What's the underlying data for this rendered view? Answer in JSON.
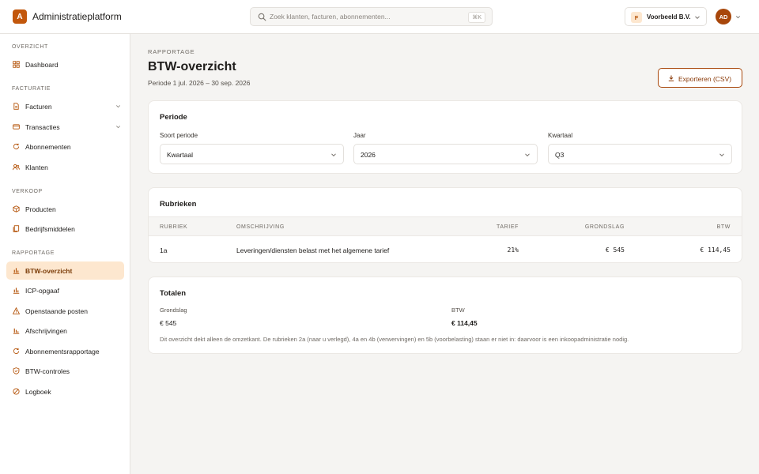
{
  "app": {
    "logo_letter": "A",
    "title": "Administratieplatform"
  },
  "search": {
    "placeholder": "Zoek klanten, facturen, abonnementen...",
    "shortcut": "⌘K"
  },
  "org": {
    "badge": "F",
    "name": "Voorbeeld B.V."
  },
  "user": {
    "initials": "AD"
  },
  "sidebar": {
    "sections": [
      {
        "label": "OVERZICHT",
        "items": [
          {
            "label": "Dashboard",
            "icon": "grid-icon"
          }
        ]
      },
      {
        "label": "FACTURATIE",
        "items": [
          {
            "label": "Facturen",
            "icon": "document-icon",
            "expandable": true
          },
          {
            "label": "Transacties",
            "icon": "card-icon",
            "expandable": true
          },
          {
            "label": "Abonnementen",
            "icon": "refresh-icon"
          },
          {
            "label": "Klanten",
            "icon": "users-icon"
          }
        ]
      },
      {
        "label": "VERKOOP",
        "items": [
          {
            "label": "Producten",
            "icon": "box-icon"
          },
          {
            "label": "Bedrijfsmiddelen",
            "icon": "files-icon"
          }
        ]
      },
      {
        "label": "RAPPORTAGE",
        "items": [
          {
            "label": "BTW-overzicht",
            "icon": "bar-chart-icon",
            "active": true
          },
          {
            "label": "ICP-opgaaf",
            "icon": "bar-chart-icon"
          },
          {
            "label": "Openstaande posten",
            "icon": "warning-icon"
          },
          {
            "label": "Afschrijvingen",
            "icon": "chart-icon"
          },
          {
            "label": "Abonnementsrapportage",
            "icon": "refresh-icon"
          },
          {
            "label": "BTW-controles",
            "icon": "shield-icon"
          },
          {
            "label": "Logboek",
            "icon": "log-icon"
          }
        ]
      }
    ]
  },
  "page": {
    "crumb": "RAPPORTAGE",
    "title": "BTW-overzicht",
    "subtitle": "Periode 1 jul. 2026 – 30 sep. 2026",
    "export_label": "Exporteren (CSV)"
  },
  "periode": {
    "title": "Periode",
    "fields": [
      {
        "label": "Soort periode",
        "value": "Kwartaal"
      },
      {
        "label": "Jaar",
        "value": "2026"
      },
      {
        "label": "Kwartaal",
        "value": "Q3"
      }
    ]
  },
  "rubrieken": {
    "title": "Rubrieken",
    "columns": [
      "RUBRIEK",
      "OMSCHRIJVING",
      "TARIEF",
      "GRONDSLAG",
      "BTW"
    ],
    "rows": [
      {
        "rubriek": "1a",
        "omschrijving": "Leveringen/diensten belast met het algemene tarief",
        "tarief": "21%",
        "grondslag": "€ 545",
        "btw": "€ 114,45"
      }
    ]
  },
  "totalen": {
    "title": "Totalen",
    "grondslag_label": "Grondslag",
    "grondslag_value": "€ 545",
    "btw_label": "BTW",
    "btw_value": "€ 114,45",
    "note": "Dit overzicht dekt alleen de omzetkant. De rubrieken 2a (naar u verlegd), 4a en 4b (verwervingen) en 5b (voorbelasting) staan er niet in: daarvoor is een inkoopadministratie nodig."
  },
  "colors": {
    "accent": "#c2570c",
    "active_bg": "#fde7cf",
    "page_bg": "#f5f4f2"
  }
}
